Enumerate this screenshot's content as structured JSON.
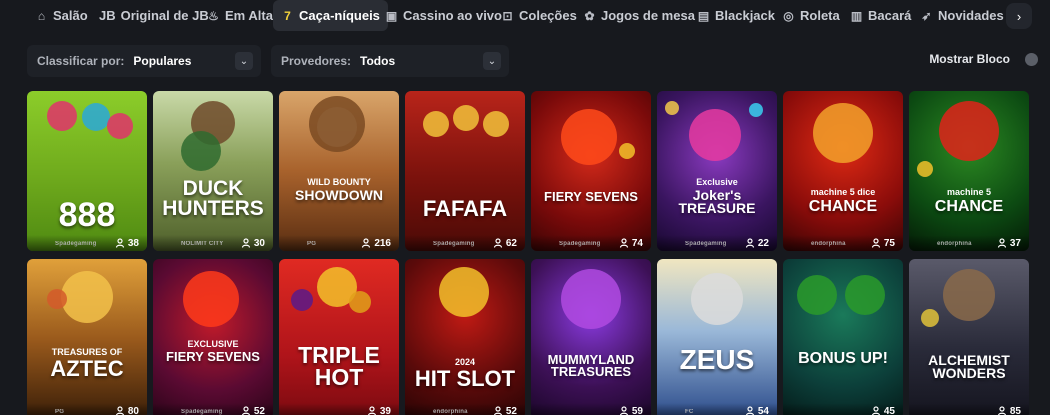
{
  "nav": {
    "items": [
      {
        "label": "Salão",
        "icon": "home-icon",
        "glyph": "⌂"
      },
      {
        "label": "Original de JB",
        "icon": "jb-logo-icon",
        "glyph": "JB"
      },
      {
        "label": "Em Alta",
        "icon": "flame-icon",
        "glyph": "♨"
      },
      {
        "label": "Caça-níqueis",
        "icon": "seven-icon",
        "glyph": "7",
        "active": true
      },
      {
        "label": "Cassino ao vivo",
        "icon": "tv-icon",
        "glyph": "▣"
      },
      {
        "label": "Coleções",
        "icon": "bookmark-icon",
        "glyph": "⊡"
      },
      {
        "label": "Jogos de mesa",
        "icon": "poker-chip-icon",
        "glyph": "✿"
      },
      {
        "label": "Blackjack",
        "icon": "cards-icon",
        "glyph": "▤"
      },
      {
        "label": "Roleta",
        "icon": "roulette-icon",
        "glyph": "◎"
      },
      {
        "label": "Bacará",
        "icon": "baccarat-icon",
        "glyph": "▥"
      },
      {
        "label": "Novidades",
        "icon": "rocket-icon",
        "glyph": "➶"
      }
    ],
    "next_glyph": "›"
  },
  "filters": {
    "sort_label": "Classificar por:",
    "sort_value": "Populares",
    "provider_label": "Provedores:",
    "provider_value": "Todos",
    "chevron": "⌄",
    "show_block_label": "Mostrar Bloco"
  },
  "games": [
    {
      "title": "888",
      "provider": "Spadegaming",
      "players": "38",
      "bg": "#7cb321"
    },
    {
      "title": "DUCK HUNTERS",
      "provider": "NOLIMIT CITY",
      "players": "30",
      "bg": "#7d8f3a"
    },
    {
      "title": "SHOWDOWN",
      "subtitle": "WILD BOUNTY",
      "provider": "PG",
      "players": "216",
      "bg": "#8c4a22"
    },
    {
      "title": "FAFAFA",
      "provider": "Spadegaming",
      "players": "62",
      "bg": "#8a1810"
    },
    {
      "title": "FIERY SEVENS",
      "provider": "Spadegaming",
      "players": "74",
      "bg": "#6b0b0b"
    },
    {
      "title": "Joker's TREASURE",
      "subtitle": "Exclusive",
      "provider": "Spadegaming",
      "players": "22",
      "bg": "#3a1560"
    },
    {
      "title": "CHANCE",
      "subtitle": "machine 5 dice",
      "provider": "endorphina",
      "players": "75",
      "bg": "#7a0c0a"
    },
    {
      "title": "CHANCE",
      "subtitle": "machine 5",
      "provider": "endorphina",
      "players": "37",
      "bg": "#0c3a0f"
    },
    {
      "title": "AZTEC",
      "subtitle": "TREASURES OF",
      "provider": "PG",
      "players": "80",
      "bg": "#6b3a12"
    },
    {
      "title": "FIERY SEVENS",
      "subtitle": "EXCLUSIVE",
      "provider": "Spadegaming",
      "players": "52",
      "bg": "#4a0a32"
    },
    {
      "title": "TRIPLE HOT",
      "provider": "",
      "players": "39",
      "bg": "#c0161c"
    },
    {
      "title": "HIT SLOT",
      "subtitle": "2024",
      "provider": "endorphina",
      "players": "52",
      "bg": "#5a0e0e"
    },
    {
      "title": "MUMMYLAND TREASURES",
      "provider": "",
      "players": "59",
      "bg": "#3c1055"
    },
    {
      "title": "ZEUS",
      "provider": "FC",
      "players": "54",
      "bg": "#3d6fb6"
    },
    {
      "title": "BONUS UP!",
      "provider": "",
      "players": "45",
      "bg": "#0c3f3a"
    },
    {
      "title": "ALCHEMIST WONDERS",
      "provider": "",
      "players": "85",
      "bg": "#2a2b3a"
    }
  ]
}
